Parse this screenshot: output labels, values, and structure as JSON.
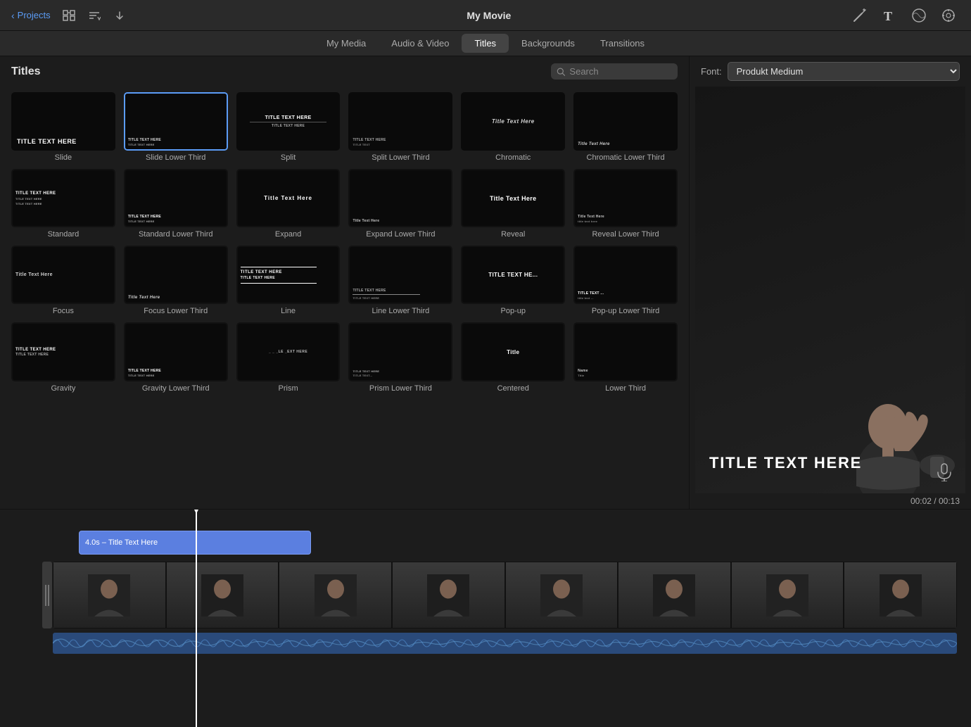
{
  "app": {
    "title": "My Movie",
    "back_label": "Projects"
  },
  "nav": {
    "tabs": [
      {
        "id": "my-media",
        "label": "My Media"
      },
      {
        "id": "audio-video",
        "label": "Audio & Video"
      },
      {
        "id": "titles",
        "label": "Titles",
        "active": true
      },
      {
        "id": "backgrounds",
        "label": "Backgrounds"
      },
      {
        "id": "transitions",
        "label": "Transitions"
      }
    ]
  },
  "titles_panel": {
    "heading": "Titles",
    "search_placeholder": "Search",
    "items": [
      {
        "id": "slide",
        "label": "Slide",
        "style": "bold-white"
      },
      {
        "id": "slide-lower-third",
        "label": "Slide Lower Third",
        "style": "small-white",
        "selected": true
      },
      {
        "id": "split",
        "label": "Split",
        "style": "split-style"
      },
      {
        "id": "split-lower-third",
        "label": "Split Lower Third",
        "style": "split-lt"
      },
      {
        "id": "chromatic",
        "label": "Chromatic",
        "style": "chromatic"
      },
      {
        "id": "chromatic-lower-third",
        "label": "Chromatic Lower Third",
        "style": "chromatic-lt"
      },
      {
        "id": "standard",
        "label": "Standard",
        "style": "standard"
      },
      {
        "id": "standard-lower-third",
        "label": "Standard Lower Third",
        "style": "standard-lt"
      },
      {
        "id": "expand",
        "label": "Expand",
        "style": "expand"
      },
      {
        "id": "expand-lower-third",
        "label": "Expand Lower Third",
        "style": "expand-lt"
      },
      {
        "id": "reveal",
        "label": "Reveal",
        "style": "reveal"
      },
      {
        "id": "reveal-lower-third",
        "label": "Reveal Lower Third",
        "style": "reveal-lt"
      },
      {
        "id": "focus",
        "label": "Focus",
        "style": "focus"
      },
      {
        "id": "focus-lower-third",
        "label": "Focus Lower Third",
        "style": "focus-lt"
      },
      {
        "id": "line",
        "label": "Line",
        "style": "line"
      },
      {
        "id": "line-lower-third",
        "label": "Line Lower Third",
        "style": "line-lt"
      },
      {
        "id": "pop-up",
        "label": "Pop-up",
        "style": "popup"
      },
      {
        "id": "pop-up-lower-third",
        "label": "Pop-up Lower Third",
        "style": "popup-lt"
      },
      {
        "id": "gravity",
        "label": "Gravity",
        "style": "gravity"
      },
      {
        "id": "gravity-lower-third",
        "label": "Gravity Lower Third",
        "style": "gravity-lt"
      },
      {
        "id": "prism",
        "label": "Prism",
        "style": "prism"
      },
      {
        "id": "prism-lower-third",
        "label": "Prism Lower Third",
        "style": "prism-lt"
      },
      {
        "id": "centered",
        "label": "Centered",
        "style": "centered"
      },
      {
        "id": "lower-third",
        "label": "Lower Third",
        "style": "lower-third"
      }
    ]
  },
  "font_bar": {
    "label": "Font:",
    "value": "Produkt Medium"
  },
  "preview": {
    "title_text": "TITLE TEXT HERE",
    "timecode": "00:02 / 00:13"
  },
  "timeline": {
    "title_clip_label": "4.0s – Title Text Here"
  }
}
